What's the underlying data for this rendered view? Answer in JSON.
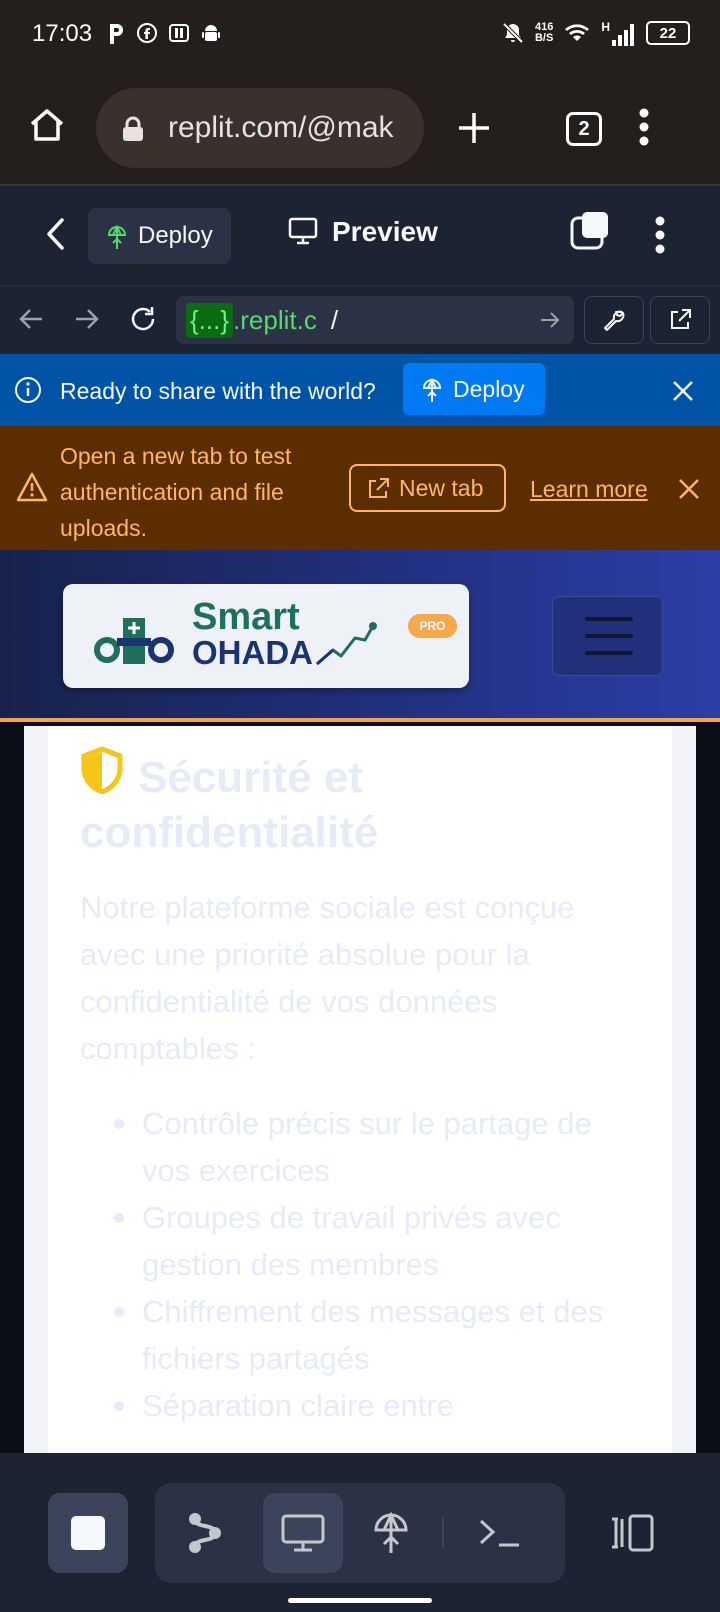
{
  "status_bar": {
    "time": "17:03",
    "net_speed_value": "416",
    "net_speed_unit": "B/S",
    "signal_label": "H",
    "battery": "22"
  },
  "browser": {
    "url": "replit.com/@mak",
    "tab_count": "2"
  },
  "replit_header": {
    "deploy_label": "Deploy",
    "preview_label": "Preview"
  },
  "webview_bar": {
    "url_prefix": "{...}",
    "url_host": ".replit.c",
    "url_path": "/"
  },
  "deploy_banner": {
    "text": "Ready to share with the world?",
    "button_label": "Deploy"
  },
  "auth_banner": {
    "text": "Open a new tab to test authentication and file uploads.",
    "new_tab_label": "New tab",
    "learn_more_label": "Learn more"
  },
  "site": {
    "logo_word_1": "Smart",
    "logo_word_2": "OHADA",
    "logo_badge": "PRO",
    "section_title": "Sécurité et confidentialité",
    "intro": "Notre plateforme sociale est conçue avec une priorité absolue pour la confidentialité de vos données comptables :",
    "bullets": [
      "Contrôle précis sur le partage de vos exercices",
      "Groupes de travail privés avec gestion des membres",
      "Chiffrement des messages et des fichiers partagés",
      "Séparation claire entre"
    ]
  },
  "colors": {
    "status_bg": "#241e1c",
    "replit_bg": "#1c2333",
    "deploy_banner": "#0053a6",
    "warning_banner": "#5c2d00",
    "warning_text": "#ffb566",
    "accent_orange": "#f6a53c",
    "shield_yellow": "#f5c518"
  }
}
